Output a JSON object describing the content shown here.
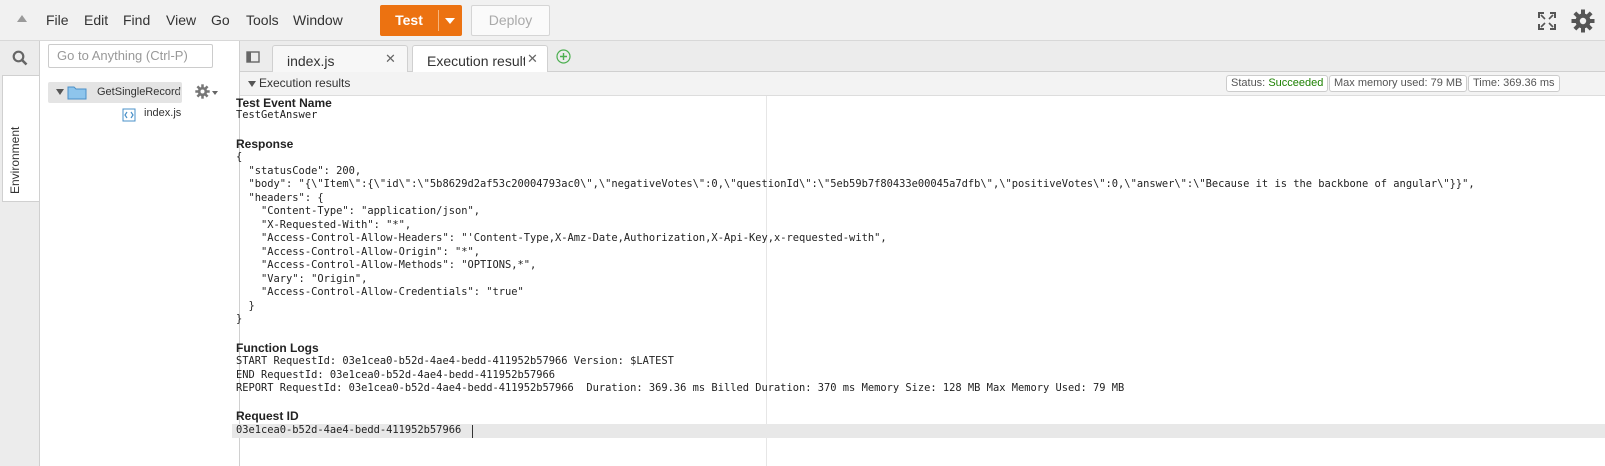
{
  "menubar": {
    "items": [
      "File",
      "Edit",
      "Find",
      "View",
      "Go",
      "Tools",
      "Window"
    ],
    "test_label": "Test",
    "deploy_label": "Deploy"
  },
  "sidebar": {
    "environment_tab_label": "Environment",
    "search_placeholder": "Go to Anything (Ctrl-P)",
    "folder_name": "GetSingleRecord",
    "folder_suffix": "/",
    "file_name": "index.js"
  },
  "tabs": [
    {
      "label": "index.js"
    },
    {
      "label": "Execution results"
    }
  ],
  "results": {
    "header_title": "Execution results",
    "status_label": "Status:",
    "status_value": "Succeeded",
    "memory_text": "Max memory used: 79 MB",
    "time_text": "Time: 369.36 ms",
    "accent_color": "#ec7211",
    "status_color": "#1d8102",
    "test_event_title": "Test Event Name",
    "test_event_value": "TestGetAnswer",
    "response_title": "Response",
    "response_lines": [
      "{",
      "  \"statusCode\": 200,",
      "  \"body\": \"{\\\"Item\\\":{\\\"id\\\":\\\"5b8629d2af53c20004793ac0\\\",\\\"negativeVotes\\\":0,\\\"questionId\\\":\\\"5eb59b7f80433e00045a7dfb\\\",\\\"positiveVotes\\\":0,\\\"answer\\\":\\\"Because it is the backbone of angular\\\"}}\",",
      "  \"headers\": {",
      "    \"Content-Type\": \"application/json\",",
      "    \"X-Requested-With\": \"*\",",
      "    \"Access-Control-Allow-Headers\": \"'Content-Type,X-Amz-Date,Authorization,X-Api-Key,x-requested-with\",",
      "    \"Access-Control-Allow-Origin\": \"*\",",
      "    \"Access-Control-Allow-Methods\": \"OPTIONS,*\",",
      "    \"Vary\": \"Origin\",",
      "    \"Access-Control-Allow-Credentials\": \"true\"",
      "  }",
      "}"
    ],
    "logs_title": "Function Logs",
    "log_lines": [
      "START RequestId: 03e1cea0-b52d-4ae4-bedd-411952b57966 Version: $LATEST",
      "END RequestId: 03e1cea0-b52d-4ae4-bedd-411952b57966",
      "REPORT RequestId: 03e1cea0-b52d-4ae4-bedd-411952b57966  Duration: 369.36 ms Billed Duration: 370 ms Memory Size: 128 MB Max Memory Used: 79 MB"
    ],
    "request_id_title": "Request ID",
    "request_id_value": "03e1cea0-b52d-4ae4-bedd-411952b57966"
  }
}
